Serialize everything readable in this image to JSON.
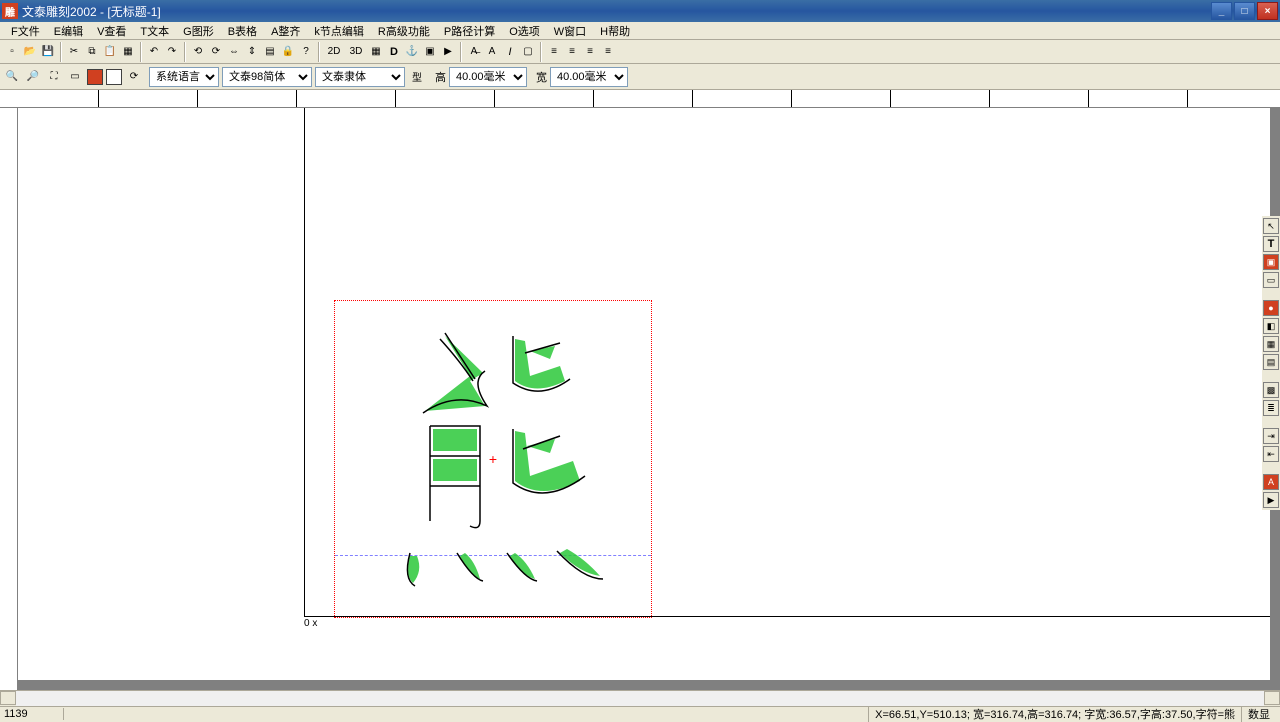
{
  "window": {
    "title": "文泰雕刻2002 - [无标题-1]"
  },
  "menu": {
    "file": "F文件",
    "edit": "E编辑",
    "view": "V查看",
    "text": "T文本",
    "graphics": "G图形",
    "table": "B表格",
    "arrange": "A整齐",
    "node": "k节点编辑",
    "advanced": "R高级功能",
    "path": "P路径计算",
    "options": "O选项",
    "window": "W窗口",
    "help": "H帮助"
  },
  "toolbar1": {
    "btn_2d": "2D",
    "btn_3d": "3D"
  },
  "props": {
    "lang_combo": "系统语言",
    "font_combo1": "文泰98简体",
    "font_combo2": "文泰隶体",
    "height_label": "高",
    "height_value": "40.00毫米",
    "width_label": "宽",
    "width_value": "40.00毫米"
  },
  "status": {
    "left": "1139",
    "coords": "X=66.51,Y=510.13; 宽=316.74,高=316.74; 字宽:36.57,字高:37.50,字符=熊",
    "mode": "数显"
  },
  "canvas": {
    "origin_label": "0 x"
  }
}
